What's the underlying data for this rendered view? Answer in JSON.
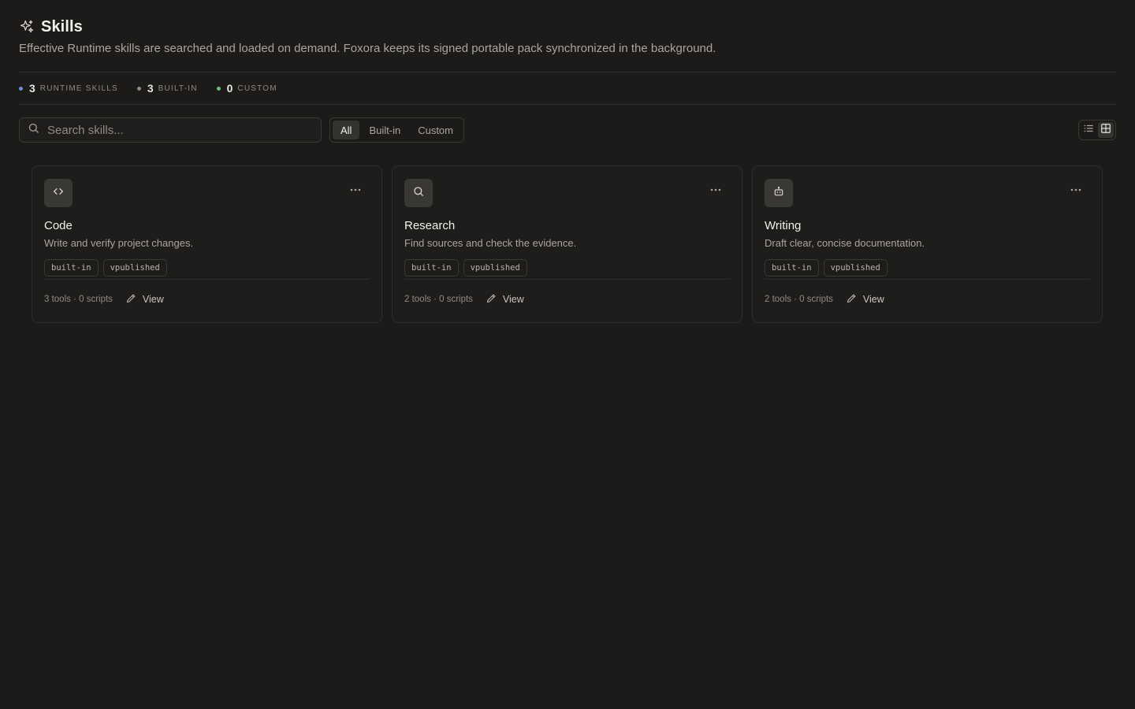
{
  "header": {
    "title": "Skills",
    "title_icon": "sparkles-icon",
    "subtitle": "Effective Runtime skills are searched and loaded on demand. Foxora keeps its signed portable pack synchronized in the background."
  },
  "stats": [
    {
      "count": "3",
      "label": "RUNTIME SKILLS",
      "dot_color": "#6b8fd6"
    },
    {
      "count": "3",
      "label": "BUILT-IN",
      "dot_color": "#8f8b85"
    },
    {
      "count": "0",
      "label": "CUSTOM",
      "dot_color": "#6fbf73"
    }
  ],
  "search": {
    "placeholder": "Search skills...",
    "value": ""
  },
  "filters": [
    {
      "label": "All",
      "active": true
    },
    {
      "label": "Built-in",
      "active": false
    },
    {
      "label": "Custom",
      "active": false
    }
  ],
  "view_toggle": {
    "options": [
      "list-view-icon",
      "grid-view-icon"
    ],
    "active": "grid-view-icon"
  },
  "cards": [
    {
      "icon": "code-icon",
      "title": "Code",
      "description": "Write and verify project changes.",
      "tags": [
        "built-in",
        "vpublished"
      ],
      "meta": "3 tools · 0 scripts",
      "action": "View"
    },
    {
      "icon": "search-icon",
      "title": "Research",
      "description": "Find sources and check the evidence.",
      "tags": [
        "built-in",
        "vpublished"
      ],
      "meta": "2 tools · 0 scripts",
      "action": "View"
    },
    {
      "icon": "bot-icon",
      "title": "Writing",
      "description": "Draft clear, concise documentation.",
      "tags": [
        "built-in",
        "vpublished"
      ],
      "meta": "2 tools · 0 scripts",
      "action": "View"
    }
  ]
}
